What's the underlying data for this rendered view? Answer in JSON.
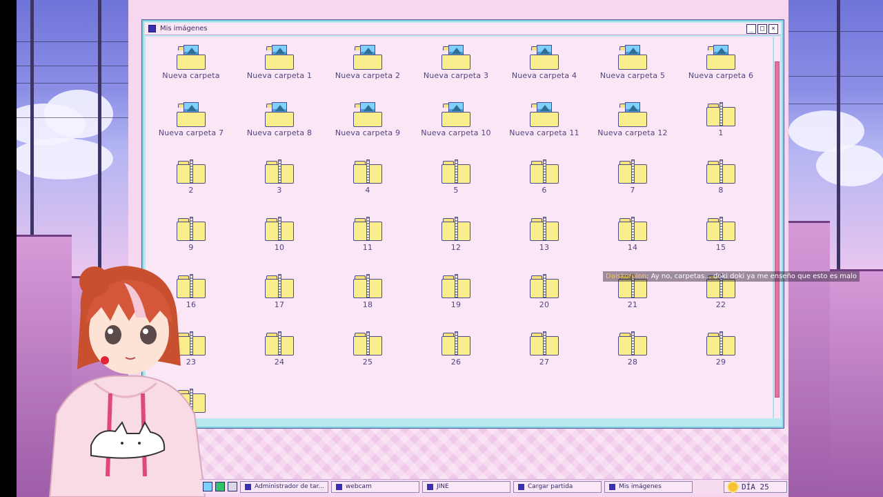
{
  "window": {
    "title": "Mis imágenes",
    "buttons": {
      "minimize": "_",
      "maximize": "□",
      "close": "×"
    }
  },
  "items": [
    {
      "label": "Nueva carpeta",
      "type": "pictures"
    },
    {
      "label": "Nueva carpeta 1",
      "type": "pictures"
    },
    {
      "label": "Nueva carpeta 2",
      "type": "pictures"
    },
    {
      "label": "Nueva carpeta 3",
      "type": "pictures"
    },
    {
      "label": "Nueva carpeta 4",
      "type": "pictures"
    },
    {
      "label": "Nueva carpeta 5",
      "type": "pictures"
    },
    {
      "label": "Nueva carpeta 6",
      "type": "pictures"
    },
    {
      "label": "Nueva carpeta 7",
      "type": "pictures"
    },
    {
      "label": "Nueva carpeta 8",
      "type": "pictures"
    },
    {
      "label": "Nueva carpeta 9",
      "type": "pictures"
    },
    {
      "label": "Nueva carpeta 10",
      "type": "pictures"
    },
    {
      "label": "Nueva carpeta 11",
      "type": "pictures"
    },
    {
      "label": "Nueva carpeta 12",
      "type": "pictures"
    },
    {
      "label": "1",
      "type": "zip"
    },
    {
      "label": "2",
      "type": "zip"
    },
    {
      "label": "3",
      "type": "zip"
    },
    {
      "label": "4",
      "type": "zip"
    },
    {
      "label": "5",
      "type": "zip"
    },
    {
      "label": "6",
      "type": "zip"
    },
    {
      "label": "7",
      "type": "zip"
    },
    {
      "label": "8",
      "type": "zip"
    },
    {
      "label": "9",
      "type": "zip"
    },
    {
      "label": "10",
      "type": "zip"
    },
    {
      "label": "11",
      "type": "zip"
    },
    {
      "label": "12",
      "type": "zip"
    },
    {
      "label": "13",
      "type": "zip"
    },
    {
      "label": "14",
      "type": "zip"
    },
    {
      "label": "15",
      "type": "zip"
    },
    {
      "label": "16",
      "type": "zip"
    },
    {
      "label": "17",
      "type": "zip"
    },
    {
      "label": "18",
      "type": "zip"
    },
    {
      "label": "19",
      "type": "zip"
    },
    {
      "label": "20",
      "type": "zip"
    },
    {
      "label": "21",
      "type": "zip"
    },
    {
      "label": "22",
      "type": "zip"
    },
    {
      "label": "23",
      "type": "zip"
    },
    {
      "label": "24",
      "type": "zip"
    },
    {
      "label": "25",
      "type": "zip"
    },
    {
      "label": "26",
      "type": "zip"
    },
    {
      "label": "27",
      "type": "zip"
    },
    {
      "label": "28",
      "type": "zip"
    },
    {
      "label": "29",
      "type": "zip"
    },
    {
      "label": "",
      "type": "zip"
    }
  ],
  "chat": {
    "user": "Daiskorpion",
    "message": ": Ay no, carpetas... doki doki ya me enseño que esto es malo"
  },
  "taskbar": {
    "tasks": [
      {
        "label": "Administrador de tar..."
      },
      {
        "label": "webcam"
      },
      {
        "label": "JINE"
      },
      {
        "label": "Cargar partida"
      },
      {
        "label": "Mis imágenes"
      }
    ],
    "day": "DÍA 25"
  },
  "colors": {
    "window_bg": "#fbe6f6",
    "window_border": "#7fd3e0",
    "folder_yellow": "#f9ed8e",
    "scroll_thumb": "#e46fa9"
  }
}
